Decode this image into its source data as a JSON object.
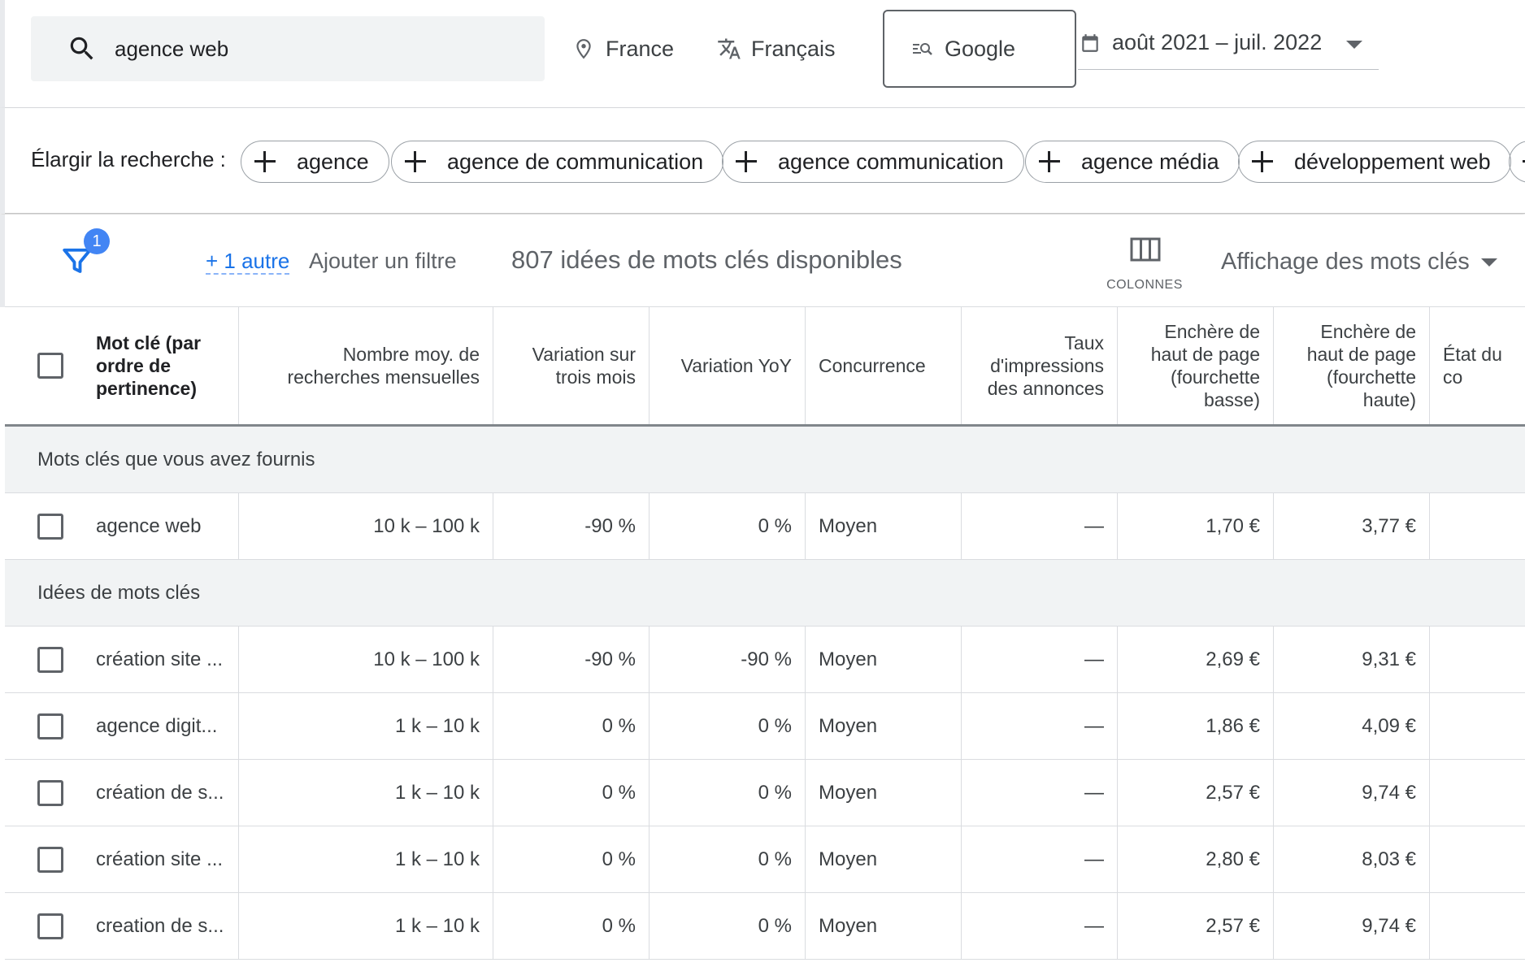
{
  "search": {
    "query": "agence web"
  },
  "filters": {
    "location": "France",
    "language": "Français",
    "network": "Google",
    "date_range": "août 2021 – juil. 2022"
  },
  "broaden": {
    "label": "Élargir la recherche :",
    "chips": [
      "agence",
      "agence de communication",
      "agence communication",
      "agence média",
      "développement web"
    ]
  },
  "toolbar": {
    "filter_badge": "1",
    "more_filters": "+ 1 autre",
    "add_filter": "Ajouter un filtre",
    "ideas_count": "807 idées de mots clés disponibles",
    "columns_label": "COLONNES",
    "view_select": "Affichage des mots clés"
  },
  "table": {
    "headers": {
      "keyword": [
        "Mot clé (par",
        "ordre de",
        "pertinence)"
      ],
      "searches": [
        "Nombre moy. de",
        "recherches mensuelles"
      ],
      "three_month": [
        "Variation sur",
        "trois mois"
      ],
      "yoy": [
        "Variation YoY"
      ],
      "competition": [
        "Concurrence"
      ],
      "impression_share": [
        "Taux",
        "d'impressions",
        "des annonces"
      ],
      "bid_low": [
        "Enchère de",
        "haut de page",
        "(fourchette",
        "basse)"
      ],
      "bid_high": [
        "Enchère de",
        "haut de page",
        "(fourchette",
        "haute)"
      ],
      "status": [
        "État du co"
      ]
    },
    "groups": [
      {
        "label": "Mots clés que vous avez fournis",
        "rows": [
          {
            "keyword": "agence web",
            "searches": "10 k – 100 k",
            "three_month": "-90 %",
            "yoy": "0 %",
            "competition": "Moyen",
            "impression_share": "—",
            "bid_low": "1,70 €",
            "bid_high": "3,77 €"
          }
        ]
      },
      {
        "label": "Idées de mots clés",
        "rows": [
          {
            "keyword": "création site ...",
            "searches": "10 k – 100 k",
            "three_month": "-90 %",
            "yoy": "-90 %",
            "competition": "Moyen",
            "impression_share": "—",
            "bid_low": "2,69 €",
            "bid_high": "9,31 €"
          },
          {
            "keyword": "agence digit...",
            "searches": "1 k – 10 k",
            "three_month": "0 %",
            "yoy": "0 %",
            "competition": "Moyen",
            "impression_share": "—",
            "bid_low": "1,86 €",
            "bid_high": "4,09 €"
          },
          {
            "keyword": "création de s...",
            "searches": "1 k – 10 k",
            "three_month": "0 %",
            "yoy": "0 %",
            "competition": "Moyen",
            "impression_share": "—",
            "bid_low": "2,57 €",
            "bid_high": "9,74 €"
          },
          {
            "keyword": "création site ...",
            "searches": "1 k – 10 k",
            "three_month": "0 %",
            "yoy": "0 %",
            "competition": "Moyen",
            "impression_share": "—",
            "bid_low": "2,80 €",
            "bid_high": "8,03 €"
          },
          {
            "keyword": "creation de s...",
            "searches": "1 k – 10 k",
            "three_month": "0 %",
            "yoy": "0 %",
            "competition": "Moyen",
            "impression_share": "—",
            "bid_low": "2,57 €",
            "bid_high": "9,74 €"
          }
        ]
      }
    ]
  },
  "colors": {
    "accent": "#1a73e8",
    "badge": "#4285f4",
    "group_bg": "#f1f3f4"
  }
}
